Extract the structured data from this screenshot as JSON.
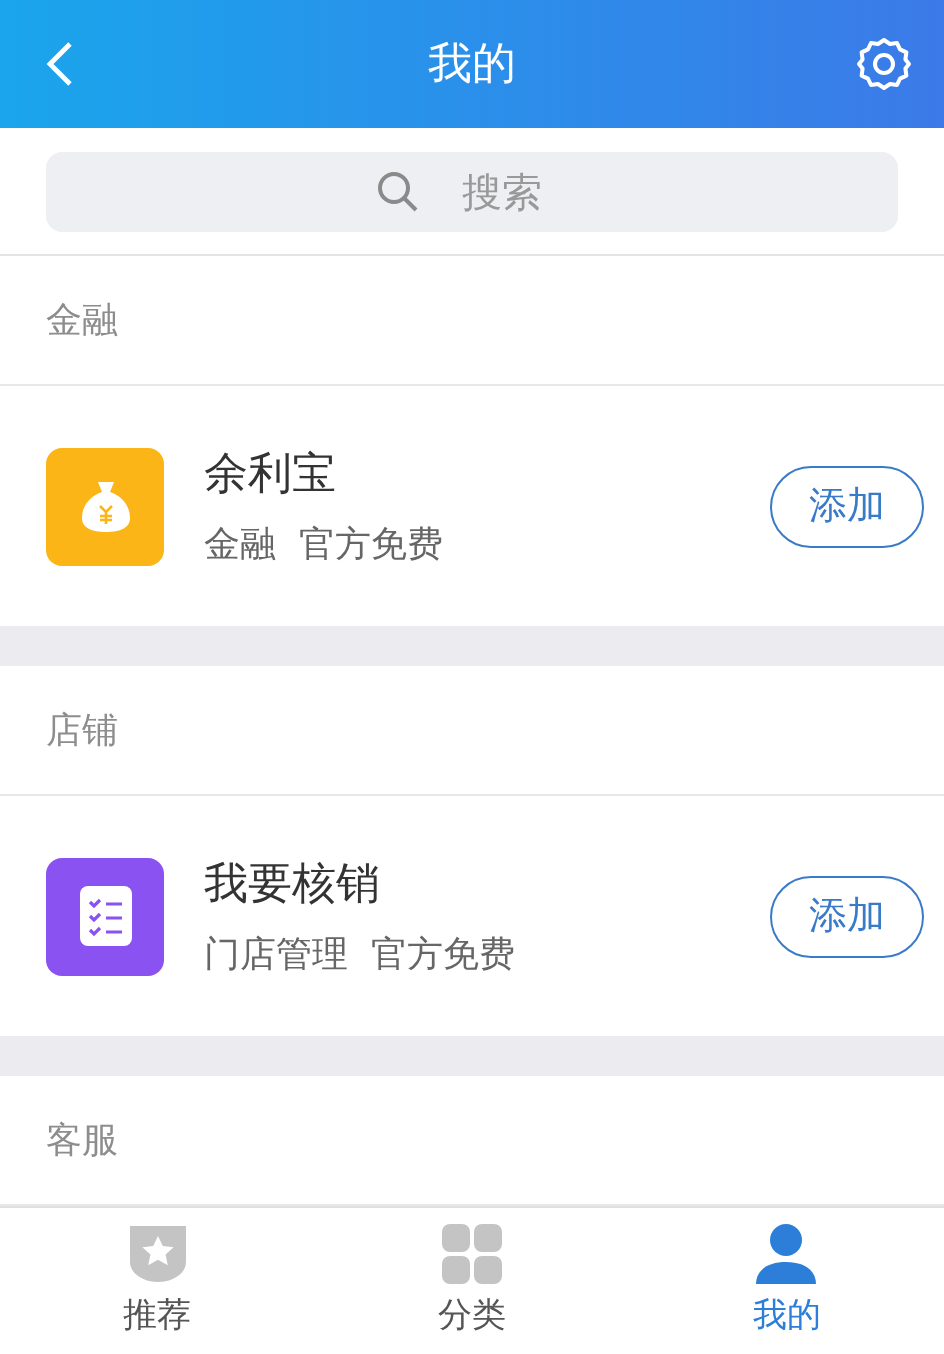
{
  "header": {
    "title": "我的"
  },
  "search": {
    "placeholder": "搜索"
  },
  "sections": [
    {
      "title": "金融",
      "items": [
        {
          "name": "余利宝",
          "tags": "金融  官方免费",
          "kind": "moneybag",
          "color": "#fbb516",
          "button": "添加"
        }
      ]
    },
    {
      "title": "店铺",
      "items": [
        {
          "name": "我要核销",
          "tags": "门店管理  官方免费",
          "kind": "checklist",
          "color": "#8a52f0",
          "button": "添加"
        }
      ]
    },
    {
      "title": "客服"
    }
  ],
  "tabs": [
    {
      "label": "推荐",
      "kind": "star",
      "selected": false
    },
    {
      "label": "分类",
      "kind": "grid",
      "selected": false
    },
    {
      "label": "我的",
      "kind": "person",
      "selected": true
    }
  ]
}
